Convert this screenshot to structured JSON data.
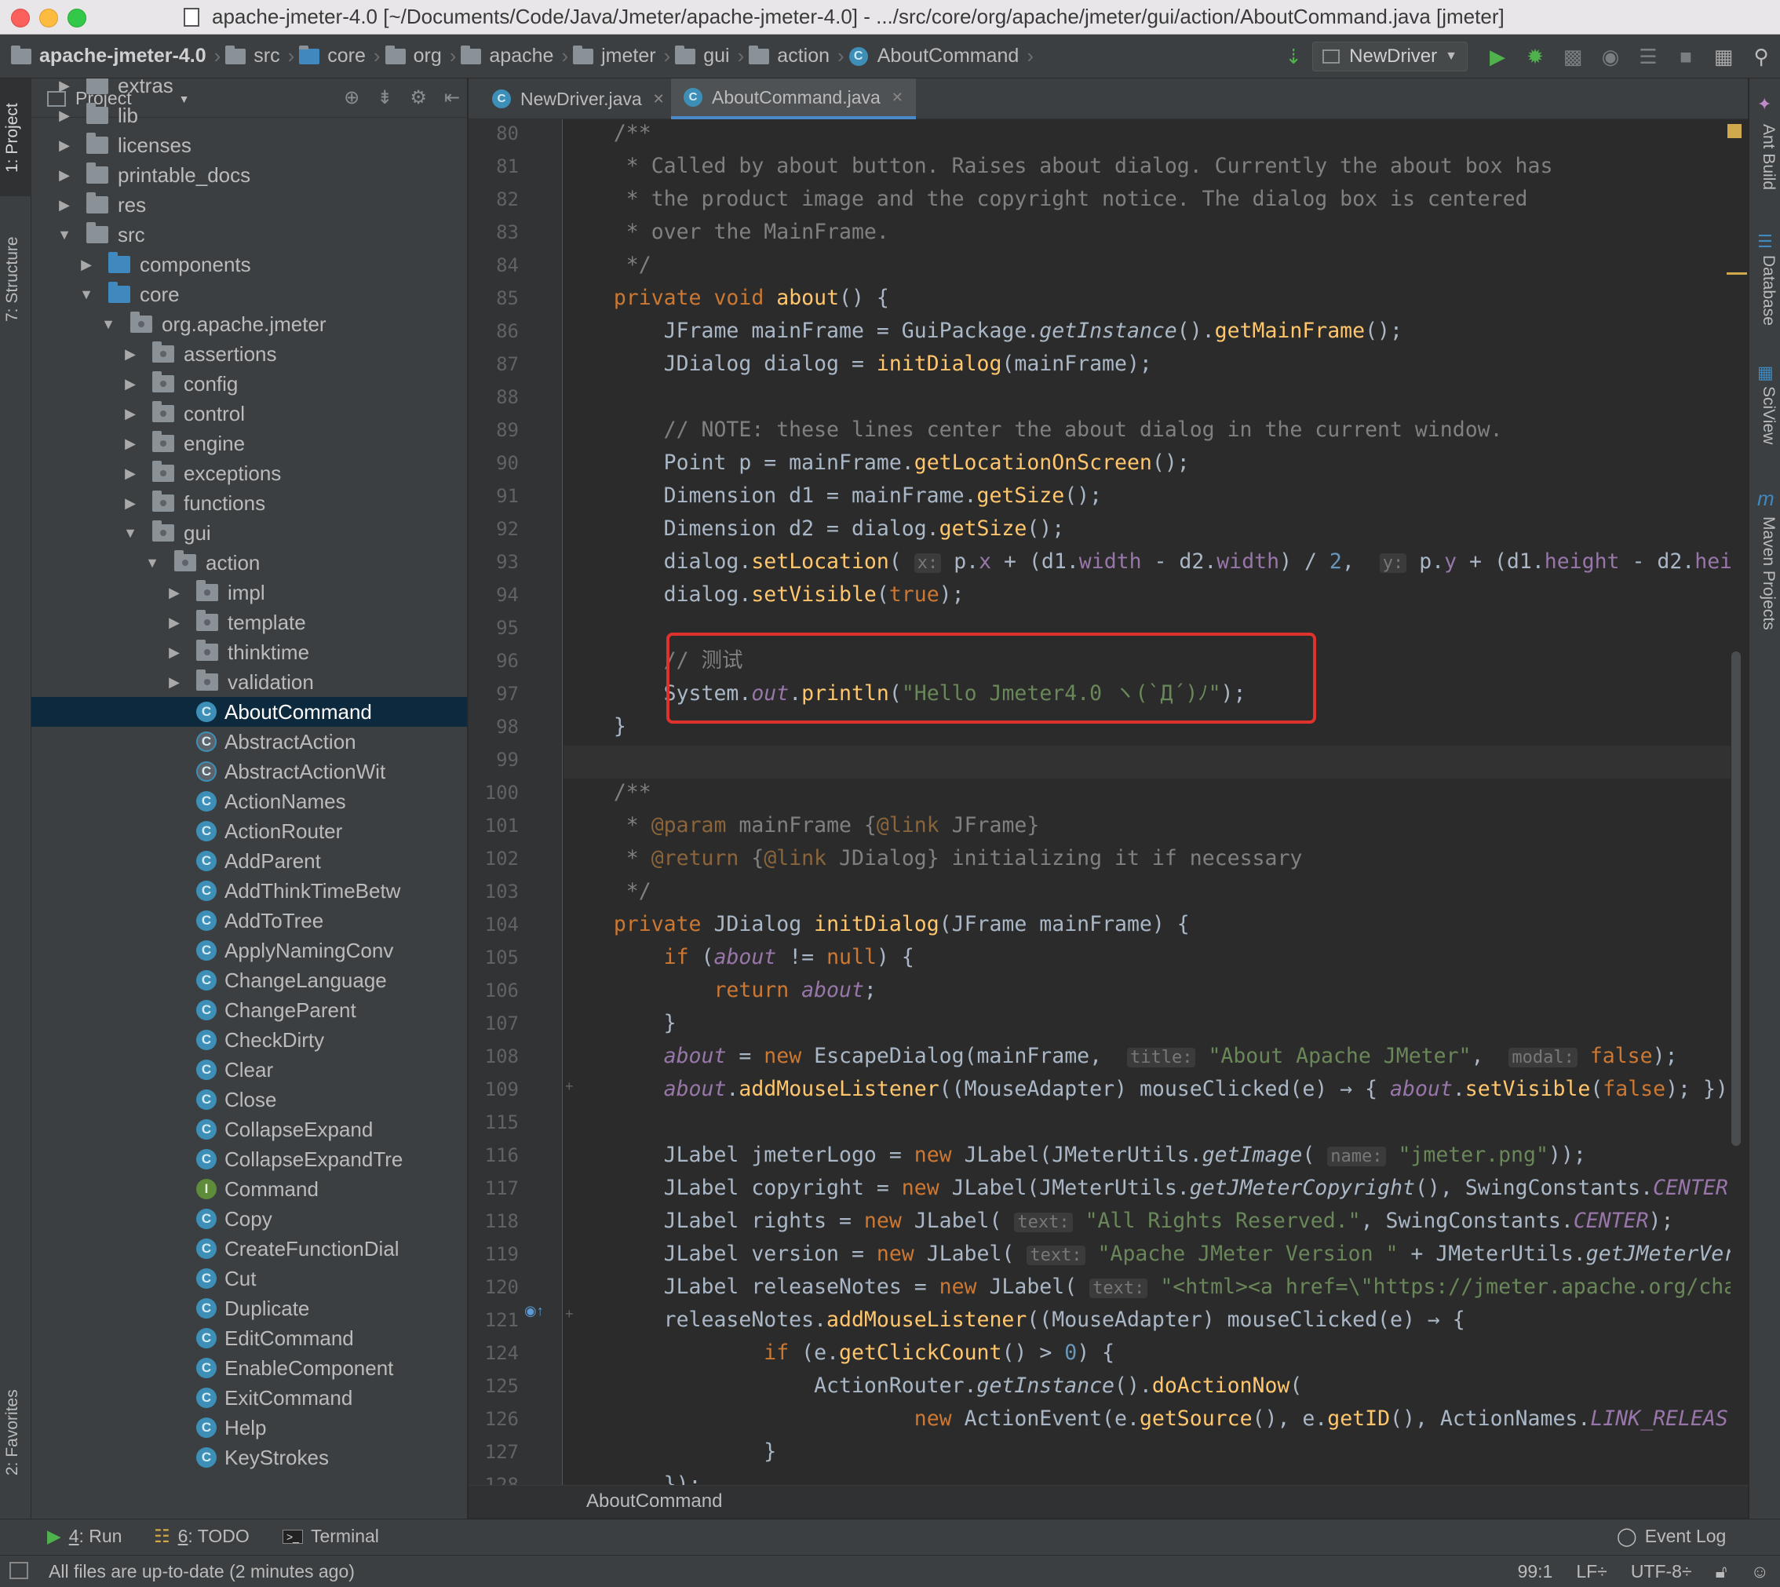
{
  "window": {
    "title": "apache-jmeter-4.0 [~/Documents/Code/Java/Jmeter/apache-jmeter-4.0] - .../src/core/org/apache/jmeter/gui/action/AboutCommand.java [jmeter]"
  },
  "navbar": {
    "crumbs": [
      "apache-jmeter-4.0",
      "src",
      "core",
      "org",
      "apache",
      "jmeter",
      "gui",
      "action",
      "AboutCommand"
    ],
    "run_config": "NewDriver"
  },
  "left_tabs": {
    "project": "1: Project",
    "structure": "7: Structure",
    "favorites": "2: Favorites"
  },
  "right_tabs": {
    "ant": "Ant Build",
    "database": "Database",
    "sciview": "SciView",
    "maven": "Maven Projects"
  },
  "project_panel": {
    "title": "Project",
    "tree": [
      {
        "label": "extras",
        "depth": 0,
        "kind": "folder",
        "arrow": "▶"
      },
      {
        "label": "lib",
        "depth": 0,
        "kind": "folder",
        "arrow": "▶"
      },
      {
        "label": "licenses",
        "depth": 0,
        "kind": "folder",
        "arrow": "▶"
      },
      {
        "label": "printable_docs",
        "depth": 0,
        "kind": "folder",
        "arrow": "▶"
      },
      {
        "label": "res",
        "depth": 0,
        "kind": "folder",
        "arrow": "▶"
      },
      {
        "label": "src",
        "depth": 0,
        "kind": "folder",
        "arrow": "▼"
      },
      {
        "label": "components",
        "depth": 1,
        "kind": "src",
        "arrow": "▶"
      },
      {
        "label": "core",
        "depth": 1,
        "kind": "src",
        "arrow": "▼"
      },
      {
        "label": "org.apache.jmeter",
        "depth": 2,
        "kind": "pkg",
        "arrow": "▼"
      },
      {
        "label": "assertions",
        "depth": 3,
        "kind": "pkg",
        "arrow": "▶"
      },
      {
        "label": "config",
        "depth": 3,
        "kind": "pkg",
        "arrow": "▶"
      },
      {
        "label": "control",
        "depth": 3,
        "kind": "pkg",
        "arrow": "▶"
      },
      {
        "label": "engine",
        "depth": 3,
        "kind": "pkg",
        "arrow": "▶"
      },
      {
        "label": "exceptions",
        "depth": 3,
        "kind": "pkg",
        "arrow": "▶"
      },
      {
        "label": "functions",
        "depth": 3,
        "kind": "pkg",
        "arrow": "▶"
      },
      {
        "label": "gui",
        "depth": 3,
        "kind": "pkg",
        "arrow": "▼"
      },
      {
        "label": "action",
        "depth": 4,
        "kind": "pkg",
        "arrow": "▼"
      },
      {
        "label": "impl",
        "depth": 5,
        "kind": "pkg",
        "arrow": "▶"
      },
      {
        "label": "template",
        "depth": 5,
        "kind": "pkg",
        "arrow": "▶"
      },
      {
        "label": "thinktime",
        "depth": 5,
        "kind": "pkg",
        "arrow": "▶"
      },
      {
        "label": "validation",
        "depth": 5,
        "kind": "pkg",
        "arrow": "▶"
      },
      {
        "label": "AboutCommand",
        "depth": 5,
        "kind": "class",
        "arrow": "",
        "selected": true
      },
      {
        "label": "AbstractAction",
        "depth": 5,
        "kind": "abstract",
        "arrow": ""
      },
      {
        "label": "AbstractActionWit",
        "depth": 5,
        "kind": "abstract",
        "arrow": ""
      },
      {
        "label": "ActionNames",
        "depth": 5,
        "kind": "class",
        "arrow": ""
      },
      {
        "label": "ActionRouter",
        "depth": 5,
        "kind": "class",
        "arrow": ""
      },
      {
        "label": "AddParent",
        "depth": 5,
        "kind": "class",
        "arrow": ""
      },
      {
        "label": "AddThinkTimeBetw",
        "depth": 5,
        "kind": "class",
        "arrow": ""
      },
      {
        "label": "AddToTree",
        "depth": 5,
        "kind": "class",
        "arrow": ""
      },
      {
        "label": "ApplyNamingConv",
        "depth": 5,
        "kind": "class",
        "arrow": ""
      },
      {
        "label": "ChangeLanguage",
        "depth": 5,
        "kind": "class",
        "arrow": ""
      },
      {
        "label": "ChangeParent",
        "depth": 5,
        "kind": "class",
        "arrow": ""
      },
      {
        "label": "CheckDirty",
        "depth": 5,
        "kind": "class",
        "arrow": ""
      },
      {
        "label": "Clear",
        "depth": 5,
        "kind": "class",
        "arrow": ""
      },
      {
        "label": "Close",
        "depth": 5,
        "kind": "class",
        "arrow": ""
      },
      {
        "label": "CollapseExpand",
        "depth": 5,
        "kind": "class",
        "arrow": ""
      },
      {
        "label": "CollapseExpandTre",
        "depth": 5,
        "kind": "class",
        "arrow": ""
      },
      {
        "label": "Command",
        "depth": 5,
        "kind": "interface",
        "arrow": ""
      },
      {
        "label": "Copy",
        "depth": 5,
        "kind": "class",
        "arrow": ""
      },
      {
        "label": "CreateFunctionDial",
        "depth": 5,
        "kind": "class",
        "arrow": ""
      },
      {
        "label": "Cut",
        "depth": 5,
        "kind": "class",
        "arrow": ""
      },
      {
        "label": "Duplicate",
        "depth": 5,
        "kind": "class",
        "arrow": ""
      },
      {
        "label": "EditCommand",
        "depth": 5,
        "kind": "class",
        "arrow": ""
      },
      {
        "label": "EnableComponent",
        "depth": 5,
        "kind": "class",
        "arrow": ""
      },
      {
        "label": "ExitCommand",
        "depth": 5,
        "kind": "class",
        "arrow": ""
      },
      {
        "label": "Help",
        "depth": 5,
        "kind": "class",
        "arrow": ""
      },
      {
        "label": "KeyStrokes",
        "depth": 5,
        "kind": "class",
        "arrow": ""
      }
    ]
  },
  "editor": {
    "tabs": [
      {
        "label": "NewDriver.java",
        "active": false
      },
      {
        "label": "AboutCommand.java",
        "active": true
      }
    ],
    "line_numbers": [
      "80",
      "81",
      "82",
      "83",
      "84",
      "85",
      "86",
      "87",
      "88",
      "89",
      "90",
      "91",
      "92",
      "93",
      "94",
      "95",
      "96",
      "97",
      "98",
      "99",
      "100",
      "101",
      "102",
      "103",
      "104",
      "105",
      "106",
      "107",
      "108",
      "109",
      "115",
      "116",
      "117",
      "118",
      "119",
      "120",
      "121",
      "124",
      "125",
      "126",
      "127",
      "128"
    ],
    "breadcrumb": "AboutCommand"
  },
  "bottom_tools": {
    "run": {
      "num": "4",
      "label": ": Run"
    },
    "todo": {
      "num": "6",
      "label": ": TODO"
    },
    "terminal": "Terminal",
    "event_log": "Event Log"
  },
  "status": {
    "message": "All files are up-to-date (2 minutes ago)",
    "position": "99:1",
    "line_sep": "LF÷",
    "encoding": "UTF-8÷"
  },
  "colors": {
    "keyword": "#cc7832",
    "method": "#ffc66d",
    "string": "#6a8759",
    "comment": "#808080",
    "field": "#9876aa",
    "highlight_box": "#e0322c"
  }
}
